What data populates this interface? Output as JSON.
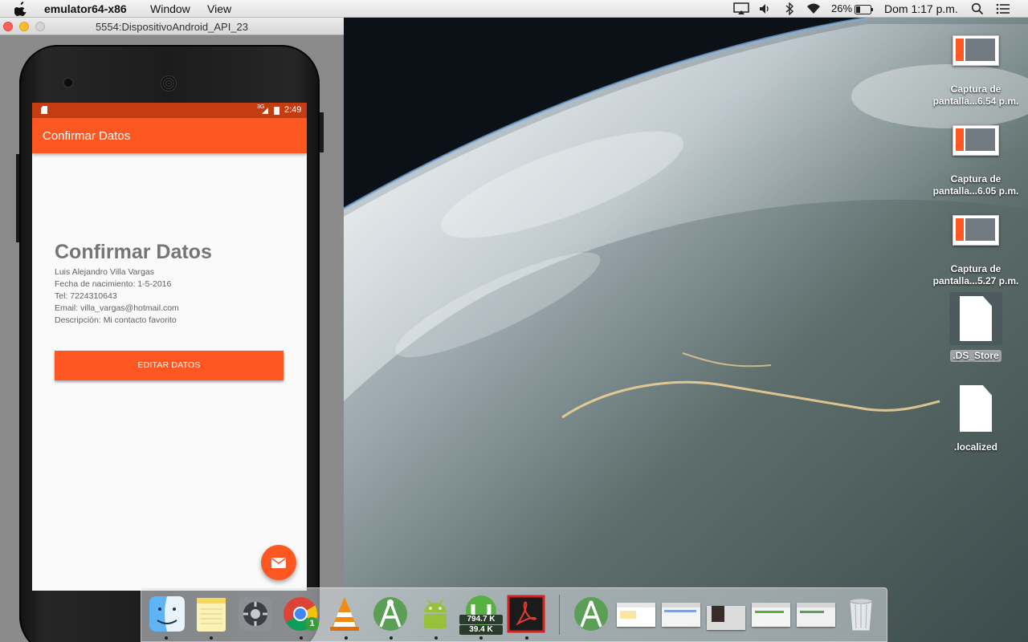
{
  "menubar": {
    "apple_icon": "apple-icon",
    "app_name": "emulator64-x86",
    "menus": [
      "Window",
      "View"
    ],
    "battery_percent": "26%",
    "clock": "Dom 1:17 p.m."
  },
  "emulator": {
    "window_title": "5554:DispositivoAndroid_API_23",
    "status_bar": {
      "time": "2:49",
      "network": "3G"
    },
    "app_bar_title": "Confirmar Datos",
    "content": {
      "heading": "Confirmar Datos",
      "name": "Luis Alejandro Villa Vargas",
      "birth": "Fecha de nacimiento:  1-5-2016",
      "phone": "Tel: 7224310643",
      "email": "Email: villa_vargas@hotmail.com",
      "description": "Descripción: Mi contacto favorito"
    },
    "edit_button": "EDITAR DATOS",
    "fab_icon": "mail-icon",
    "accent_color": "#ff5722",
    "status_color": "#c43d12"
  },
  "desktop": {
    "items": [
      {
        "line1": "Captura de",
        "line2": "pantalla...6.54 p.m."
      },
      {
        "line1": "Captura de",
        "line2": "pantalla...6.05 p.m."
      },
      {
        "line1": "Captura de",
        "line2": "pantalla...5.27 p.m."
      }
    ],
    "files": [
      ".DS_Store",
      ".localized"
    ]
  },
  "dock": {
    "apps": [
      "finder-icon",
      "notes-icon",
      "system-preferences-icon",
      "chrome-icon",
      "vlc-icon",
      "android-studio-icon",
      "android-icon",
      "torrent-icon",
      "acrobat-icon"
    ],
    "chrome_badge": "1",
    "torrent_down": "794.7 K",
    "torrent_up": "39.4 K",
    "trash_icon": "trash-icon"
  }
}
